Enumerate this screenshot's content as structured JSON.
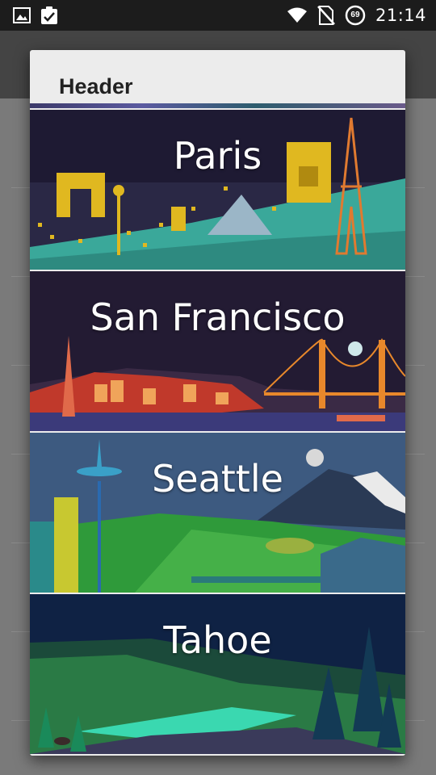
{
  "status_bar": {
    "time": "21:14",
    "left_icons": [
      "image-icon",
      "clipboard-check-icon"
    ],
    "right_icons": [
      "wifi-icon",
      "no-sim-icon",
      "data-saver-icon"
    ],
    "badge": "69"
  },
  "dialog": {
    "title": "Header",
    "items": [
      {
        "label": "Paris"
      },
      {
        "label": "San Francisco"
      },
      {
        "label": "Seattle"
      },
      {
        "label": "Tahoe"
      }
    ]
  },
  "colors": {
    "status_bar": "#1c1c1c",
    "dialog_bg": "#ececec",
    "paris_sky": "#1e1a33",
    "sf_sky": "#231b33",
    "seattle_sky": "#3d5a80",
    "tahoe_sky": "#0f2244"
  }
}
